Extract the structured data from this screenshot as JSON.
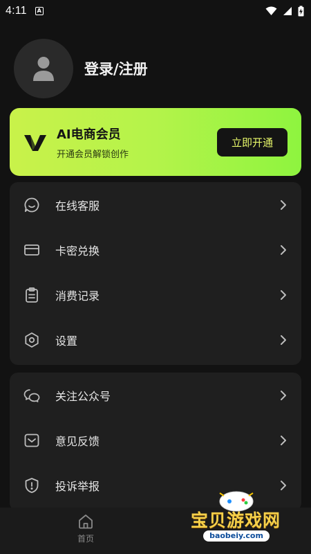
{
  "status_bar": {
    "time": "4:11",
    "icons": [
      "a-notification-icon",
      "wifi-icon",
      "signal-icon",
      "battery-charging-icon"
    ]
  },
  "profile": {
    "login_label": "登录/注册"
  },
  "vip": {
    "title": "AI电商会员",
    "subtitle": "开通会员解锁创作",
    "button_label": "立即开通",
    "colors": {
      "gradient_start": "#c9f24a",
      "gradient_end": "#8ef43f",
      "button_text": "#e7f76a"
    }
  },
  "menu_group_1": {
    "items": [
      {
        "label": "在线客服",
        "icon": "chat-bubble-icon"
      },
      {
        "label": "卡密兑换",
        "icon": "card-icon"
      },
      {
        "label": "消费记录",
        "icon": "clipboard-icon"
      },
      {
        "label": "设置",
        "icon": "settings-hexagon-icon"
      }
    ]
  },
  "menu_group_2": {
    "items": [
      {
        "label": "关注公众号",
        "icon": "wechat-icon"
      },
      {
        "label": "意见反馈",
        "icon": "mail-icon"
      },
      {
        "label": "投诉举报",
        "icon": "shield-alert-icon"
      }
    ]
  },
  "bottom_nav": {
    "home_label": "首页"
  },
  "watermark": {
    "text": "宝贝游戏网",
    "url": "baobeiy.com"
  }
}
